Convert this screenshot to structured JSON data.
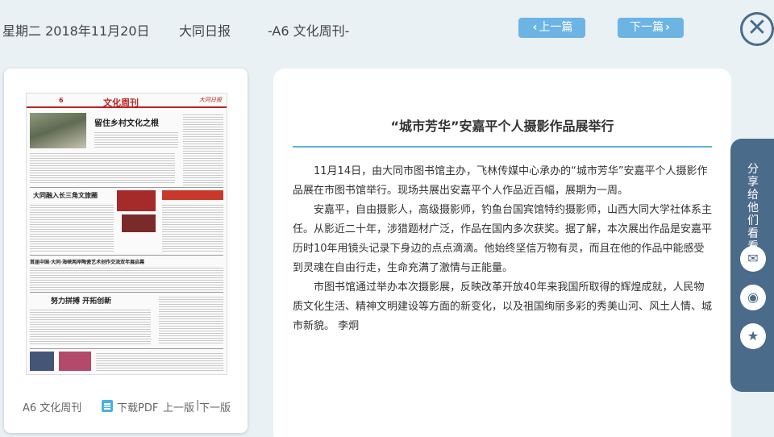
{
  "header": {
    "date": "星期二 2018年11月20日",
    "newspaper": "大同日报",
    "page": "-A6 文化周刊-",
    "prev_article": "上一篇",
    "next_article": "下一篇",
    "close_symbol": "✕",
    "prev_chevron": "‹",
    "next_chevron": "›"
  },
  "thumbnail": {
    "masthead": "文化周刊",
    "logo": "大同日报",
    "page_number": "6",
    "headlines": [
      "留住乡村文化之根",
      "大同融入长三角文旅圈",
      "首届中国·大同·海峡两岸陶瓷艺术创作交流双年展启幕",
      "努力拼搏 开拓创新"
    ],
    "footer": {
      "page_label": "A6 文化周刊",
      "pdf_link": "下载PDF",
      "prev_page": "上一版",
      "separator": "|",
      "next_page": "下一版"
    }
  },
  "article": {
    "title": "“城市芳华”安嘉平个人摄影作品展举行",
    "paragraphs": [
      "11月14日，由大同市图书馆主办，飞林传媒中心承办的“城市芳华”安嘉平个人摄影作品展在市图书馆举行。现场共展出安嘉平个人作品近百幅，展期为一周。",
      "安嘉平，自由摄影人，高级摄影师，钓鱼台国宾馆特约摄影师，山西大同大学社体系主任。从影近二十年，涉猎题材广泛，作品在国内多次获奖。据了解，本次展出作品是安嘉平历时10年用镜头记录下身边的点点滴滴。他始终坚信万物有灵，而且在他的作品中能感受到灵魂在自由行走，生命充满了激情与正能量。",
      "市图书馆通过举办本次摄影展，反映改革开放40年来我国所取得的辉煌成就，人民物质文化生活、精神文明建设等方面的新变化，以及祖国绚丽多彩的秀美山河、风土人情、城市新貌。 李炯"
    ]
  },
  "share": {
    "label": "分享给他们看看",
    "icons": [
      "wechat-icon",
      "weibo-icon",
      "favorite-icon"
    ],
    "wechat_glyph": "✉",
    "weibo_glyph": "◉",
    "favorite_glyph": "★"
  },
  "colors": {
    "background": "#e9f1f5",
    "nav_button": "#6cb4e4",
    "accent_line": "#5eb2df",
    "share_tab": "#4a6b89",
    "close_icon": "#4a6c8c",
    "masthead_red": "#b22222"
  }
}
